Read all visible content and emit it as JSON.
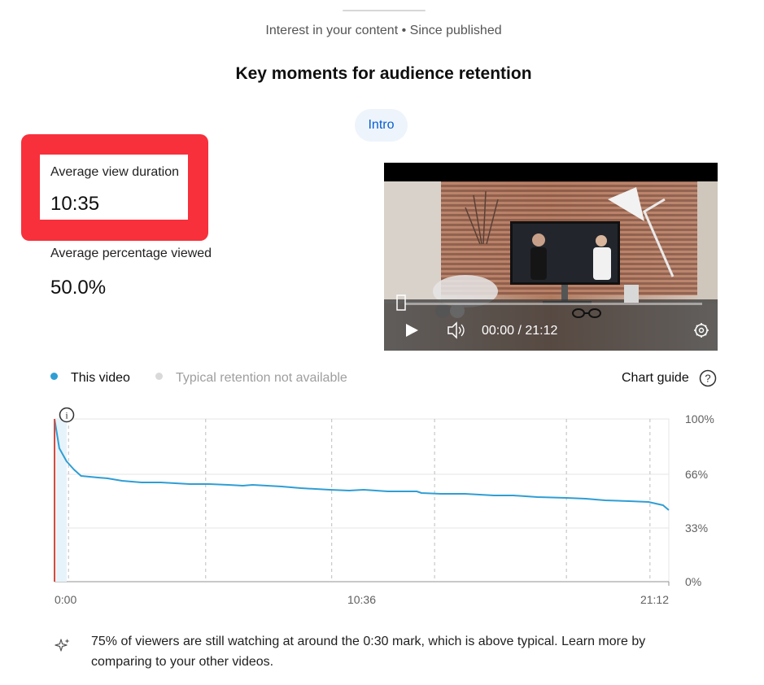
{
  "header": {
    "subtitle": "Interest in your content • Since published",
    "title": "Key moments for audience retention",
    "chip_label": "Intro"
  },
  "metrics": {
    "avg_view_duration_label": "Average view duration",
    "avg_view_duration_value": "10:35",
    "avg_percentage_label": "Average percentage viewed",
    "avg_percentage_value": "50.0%"
  },
  "video_player": {
    "time_display": "00:00 / 21:12"
  },
  "legend": {
    "this_video": "This video",
    "typical": "Typical retention not available",
    "chart_guide": "Chart guide"
  },
  "colors": {
    "series": "#2f9ed4",
    "highlight": "#f7303b",
    "typical_dot": "#d9d9d9",
    "chip_text": "#065fd4"
  },
  "chart_data": {
    "type": "line",
    "x_tick_labels": [
      "0:00",
      "10:36",
      "21:12"
    ],
    "y_tick_labels": [
      "100%",
      "66%",
      "33%",
      "0%"
    ],
    "ylim": [
      0,
      100
    ],
    "x_domain_seconds": [
      0,
      1272
    ],
    "series": [
      {
        "name": "This video",
        "points": [
          [
            0,
            100
          ],
          [
            10,
            82
          ],
          [
            25,
            74
          ],
          [
            40,
            69
          ],
          [
            55,
            65
          ],
          [
            90,
            64
          ],
          [
            110,
            63.5
          ],
          [
            140,
            62
          ],
          [
            180,
            61
          ],
          [
            220,
            61
          ],
          [
            280,
            60
          ],
          [
            320,
            60
          ],
          [
            360,
            59.5
          ],
          [
            390,
            59
          ],
          [
            410,
            59.5
          ],
          [
            440,
            59
          ],
          [
            470,
            58.5
          ],
          [
            510,
            57.5
          ],
          [
            570,
            56.5
          ],
          [
            610,
            56
          ],
          [
            640,
            56.5
          ],
          [
            690,
            55.5
          ],
          [
            750,
            55.5
          ],
          [
            760,
            54.5
          ],
          [
            800,
            54
          ],
          [
            850,
            54
          ],
          [
            880,
            53.5
          ],
          [
            910,
            53
          ],
          [
            950,
            53
          ],
          [
            1000,
            52
          ],
          [
            1060,
            51.5
          ],
          [
            1100,
            51
          ],
          [
            1140,
            50
          ],
          [
            1190,
            49.5
          ],
          [
            1230,
            49
          ],
          [
            1260,
            47
          ],
          [
            1272,
            44
          ]
        ]
      }
    ],
    "annotation": "i",
    "vertical_markers_seconds": [
      29,
      313,
      574,
      787,
      1060,
      1233
    ]
  },
  "insight": {
    "text": "75% of viewers are still watching at around the 0:30 mark, which is above typical. Learn more by comparing to your other videos."
  }
}
